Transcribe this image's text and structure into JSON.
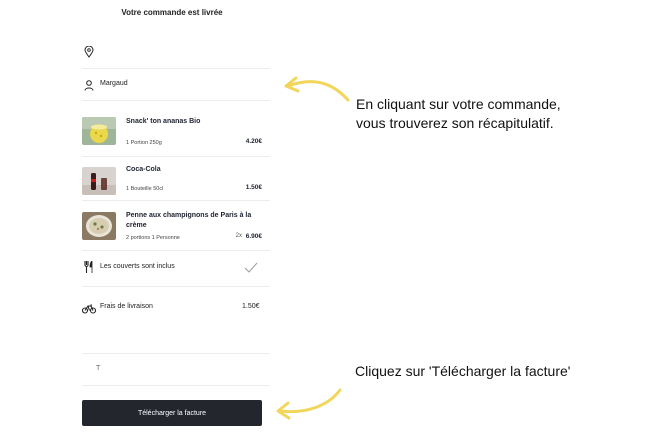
{
  "order": {
    "title": "Votre commande est livrée",
    "location_text": "",
    "customer_name": "Margaud",
    "items": [
      {
        "name": "Snack' ton ananas Bio",
        "qty": "1 Portion 250g",
        "multiplier": "",
        "price": "4.20€"
      },
      {
        "name": "Coca-Cola",
        "qty": "1 Bouteille 50cl",
        "multiplier": "",
        "price": "1.50€"
      },
      {
        "name": "Penne aux champignons de Paris à la crème",
        "qty": "2 portions 1 Personne",
        "multiplier": "2x",
        "price": "6.90€"
      }
    ],
    "cutlery_text": "Les couverts sont inclus",
    "delivery_label": "Frais de livraison",
    "delivery_price": "1.50€",
    "partial_label": "T",
    "download_button": "Télécharger la facture"
  },
  "annotations": {
    "line1a": "En cliquant sur votre commande,",
    "line1b": "vous trouverez son récapitulatif.",
    "line2": "Cliquez sur 'Télécharger la facture'"
  },
  "icons": [
    "location-pin-icon",
    "user-icon",
    "cutlery-icon",
    "checkmark-icon",
    "bike-icon"
  ],
  "colors": {
    "button_bg": "#24262e",
    "arrow": "#f2d65c",
    "divider": "#ececec"
  }
}
